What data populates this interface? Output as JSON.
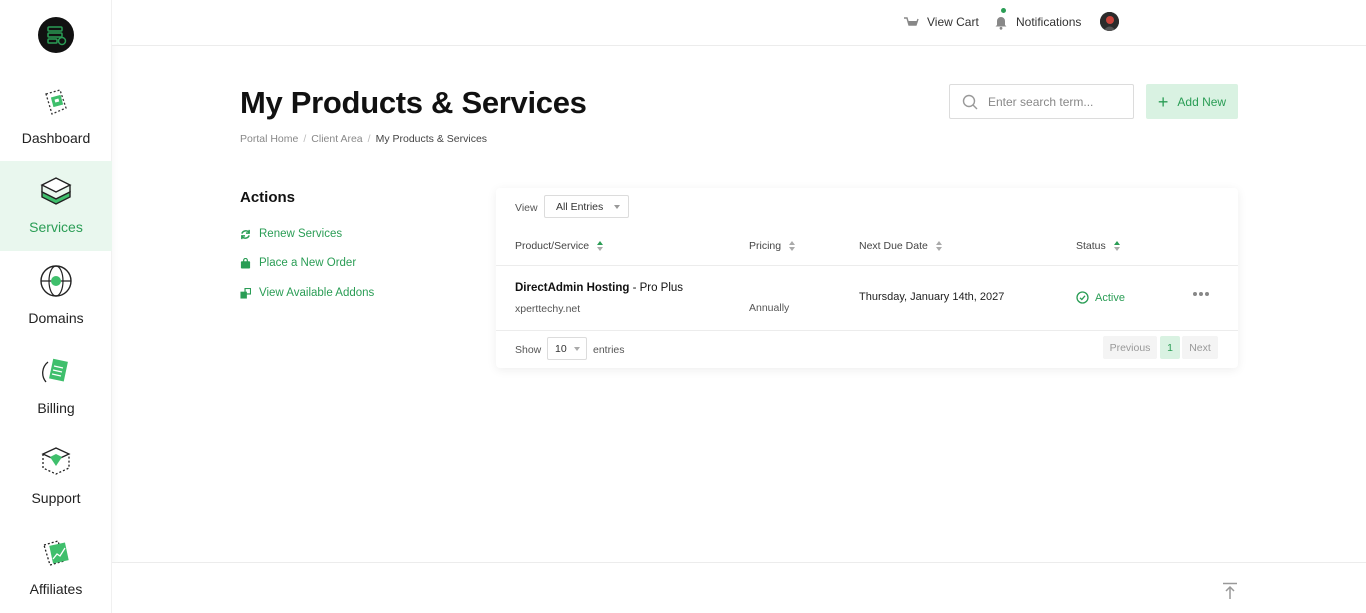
{
  "sidebar": {
    "items": [
      {
        "label": "Dashboard"
      },
      {
        "label": "Services"
      },
      {
        "label": "Domains"
      },
      {
        "label": "Billing"
      },
      {
        "label": "Support"
      },
      {
        "label": "Affiliates"
      }
    ],
    "active_item": "Services"
  },
  "topbar": {
    "view_cart": "View Cart",
    "notifications": "Notifications"
  },
  "header": {
    "title": "My Products & Services",
    "breadcrumb": [
      "Portal Home",
      "Client Area",
      "My Products & Services"
    ],
    "search_placeholder": "Enter search term...",
    "add_new": "Add New"
  },
  "actions": {
    "title": "Actions",
    "links": [
      {
        "label": "Renew Services",
        "icon": "refresh-icon"
      },
      {
        "label": "Place a New Order",
        "icon": "shopping-bag-icon"
      },
      {
        "label": "View Available Addons",
        "icon": "addons-icon"
      }
    ]
  },
  "table": {
    "view_label": "View",
    "view_value": "All Entries",
    "columns": [
      "Product/Service",
      "Pricing",
      "Next Due Date",
      "Status"
    ],
    "rows": [
      {
        "product_bold": "DirectAdmin Hosting",
        "product_rest": " - Pro Plus",
        "domain": "xperttechy.net",
        "pricing": "Annually",
        "next_due": "Thursday, January 14th, 2027",
        "status": "Active"
      }
    ],
    "show_label": "Show",
    "show_value": "10",
    "entries_label": "entries",
    "pagination": {
      "previous": "Previous",
      "current": "1",
      "next": "Next"
    }
  },
  "colors": {
    "accent": "#2a9d55",
    "accent_light": "#d9f2e2",
    "active_nav_bg": "#e9f7ee"
  }
}
